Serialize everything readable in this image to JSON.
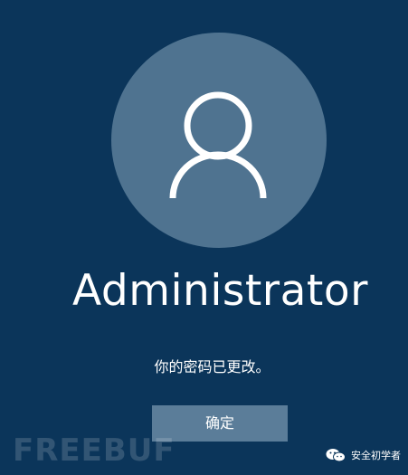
{
  "user": {
    "name": "Administrator"
  },
  "dialog": {
    "message": "你的密码已更改。",
    "ok_label": "确定"
  },
  "watermarks": {
    "left_text": "FREEBUF",
    "right_text": "安全初学者",
    "right_icon": "wechat-icon"
  },
  "colors": {
    "background": "#0b355a",
    "avatar_circle": "#4f7390",
    "button": "#5b7d99",
    "text": "#ffffff"
  }
}
